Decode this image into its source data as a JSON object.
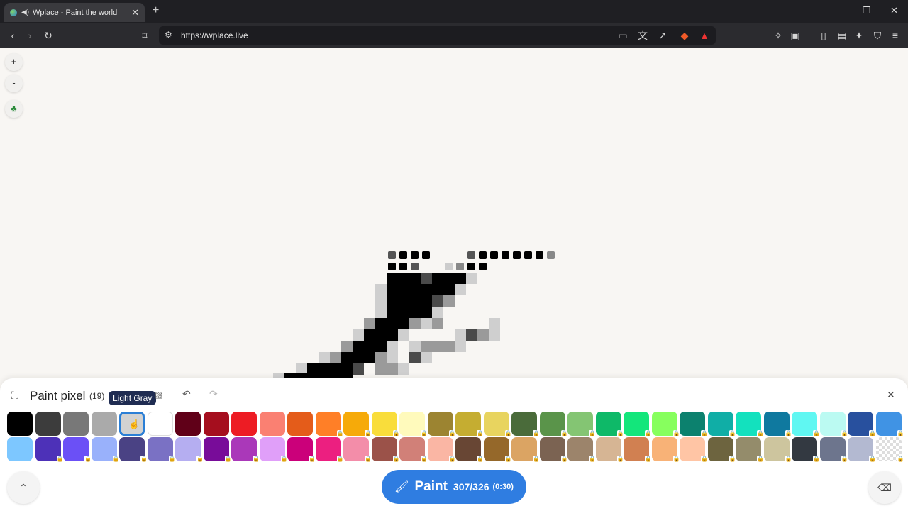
{
  "browser": {
    "tab_title": "Wplace - Paint the world",
    "url": "https://wplace.live"
  },
  "map_controls": {
    "zoom_in": "+",
    "zoom_out": "-"
  },
  "panel": {
    "title": "Paint pixel",
    "count": "(19)",
    "tooltip": "Light Gray",
    "selected_color": "Light Gray"
  },
  "palette": [
    [
      "#000000",
      "#3c3c3c",
      "#787878",
      "#aaaaaa",
      "#d2d2d2",
      "#ffffff",
      "#600018",
      "#a50e1e",
      "#ed1c24",
      "#fa8072",
      "#e45c1a",
      "#ff7f27",
      "#f6aa09",
      "#f9dd3b",
      "#fffabc",
      "#9c8431",
      "#c5ad31",
      "#e8d45f",
      "#4a6b3a",
      "#5a944a",
      "#84c573",
      "#0eb968",
      "#13e67b",
      "#87ff5e",
      "#0c816e",
      "#10aea6",
      "#13e1be",
      "#0f799f",
      "#60f7f2",
      "#bbfaf2",
      "#28509e",
      "#4093e4"
    ],
    [
      "#7dc7ff",
      "#4d31b8",
      "#6b50f6",
      "#99b1fb",
      "#4a4284",
      "#7a71c4",
      "#b5aef1",
      "#780c99",
      "#aa38b9",
      "#e09ff9",
      "#cb007a",
      "#ec1f80",
      "#f38da9",
      "#9b5249",
      "#d18078",
      "#fab6a4",
      "#684634",
      "#95682a",
      "#dba463",
      "#7b6352",
      "#9c846b",
      "#d6b594",
      "#d18051",
      "#f8b277",
      "#ffc5a5",
      "#6d643f",
      "#948c6b",
      "#cdc59e",
      "#333941",
      "#6d758d",
      "#b3b9d1",
      "#checker"
    ]
  ],
  "locked": {
    "row1": [
      11,
      12,
      13,
      14,
      15,
      16,
      17,
      18,
      19,
      20,
      21,
      22,
      23,
      24,
      25,
      26,
      27,
      28,
      29,
      30,
      31
    ],
    "row2": [
      1,
      2,
      3,
      4,
      5,
      6,
      7,
      8,
      9,
      10,
      11,
      12,
      13,
      14,
      15,
      16,
      17,
      18,
      19,
      20,
      21,
      22,
      23,
      24,
      25,
      26,
      27,
      28,
      29,
      30,
      31
    ]
  },
  "paint_button": {
    "label": "Paint",
    "count": "307/326",
    "timer": "(0:30)"
  }
}
